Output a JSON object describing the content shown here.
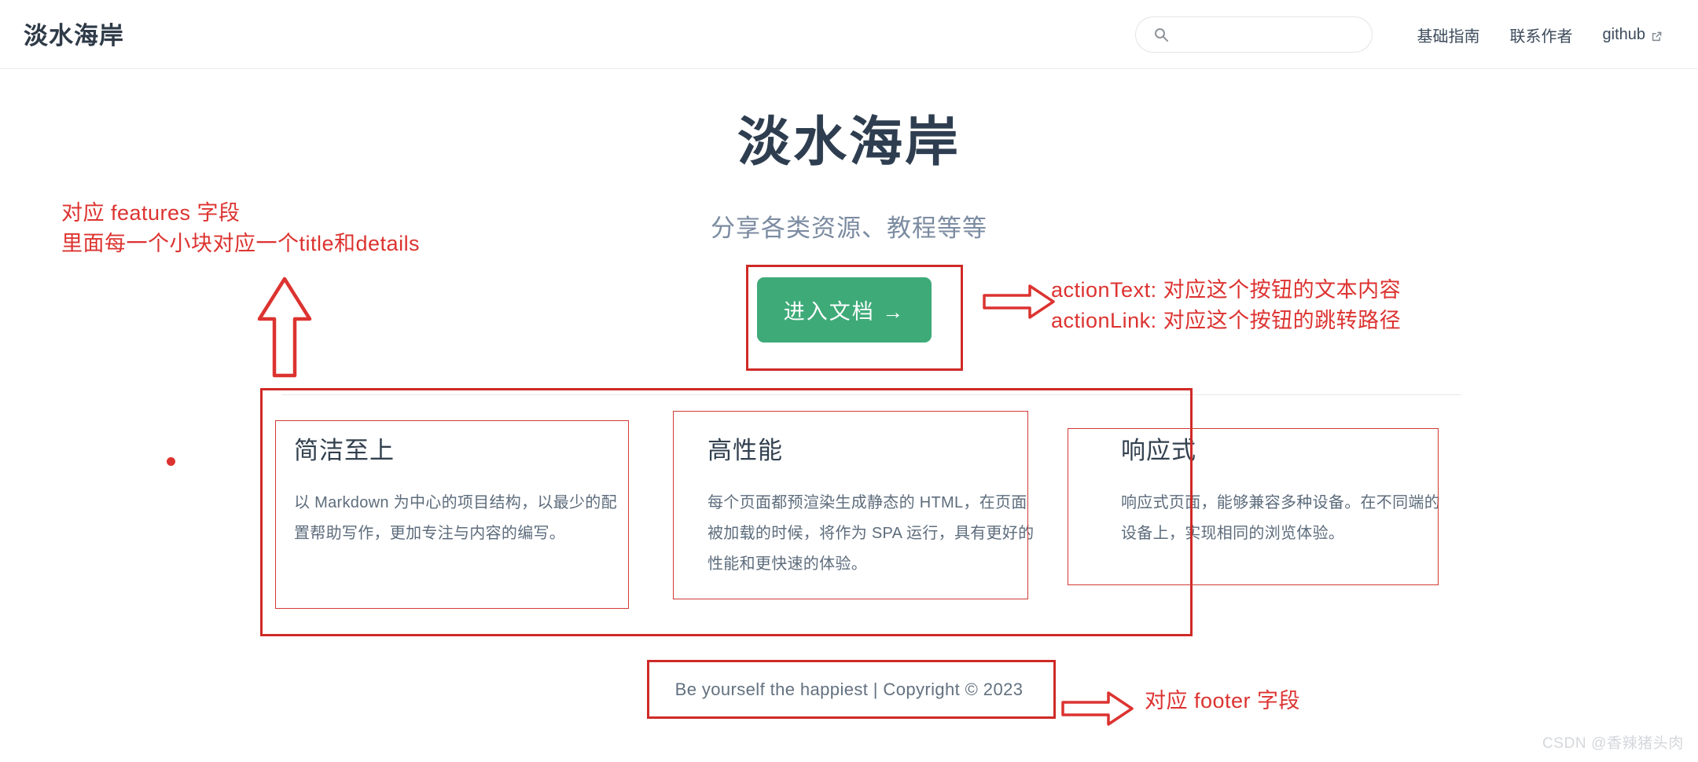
{
  "site": {
    "brand": "淡水海岸",
    "watermark": "CSDN @香辣猪头肉"
  },
  "nav": {
    "search": {
      "placeholder": "",
      "value": "",
      "icon": "search-icon"
    },
    "links": [
      {
        "label": "基础指南",
        "external": false
      },
      {
        "label": "联系作者",
        "external": false
      },
      {
        "label": "github",
        "external": true
      }
    ]
  },
  "hero": {
    "title": "淡水海岸",
    "tagline": "分享各类资源、教程等等",
    "actionText": "进入文档 →"
  },
  "features": [
    {
      "title": "简洁至上",
      "details": "以 Markdown 为中心的项目结构，以最少的配置帮助写作，更加专注与内容的编写。"
    },
    {
      "title": "高性能",
      "details": "每个页面都预渲染生成静态的 HTML，在页面被加载的时候，将作为 SPA 运行，具有更好的性能和更快速的体验。"
    },
    {
      "title": "响应式",
      "details": "响应式页面，能够兼容多种设备。在不同端的设备上，实现相同的浏览体验。"
    }
  ],
  "footer": {
    "text": "Be yourself the happiest | Copyright © 2023"
  },
  "annotations": {
    "features_line1": "对应 features 字段",
    "features_line2": "里面每一个小块对应一个title和details",
    "action_line1": "actionText: 对应这个按钮的文本内容",
    "action_line2": "actionLink: 对应这个按钮的跳转路径",
    "footer_label": "对应 footer 字段"
  },
  "colors": {
    "accent_green": "#3eaa78",
    "annotation_red": "#dc3330",
    "heading_navy": "#2e3e50",
    "tagline_slate": "#7b8ba1"
  }
}
